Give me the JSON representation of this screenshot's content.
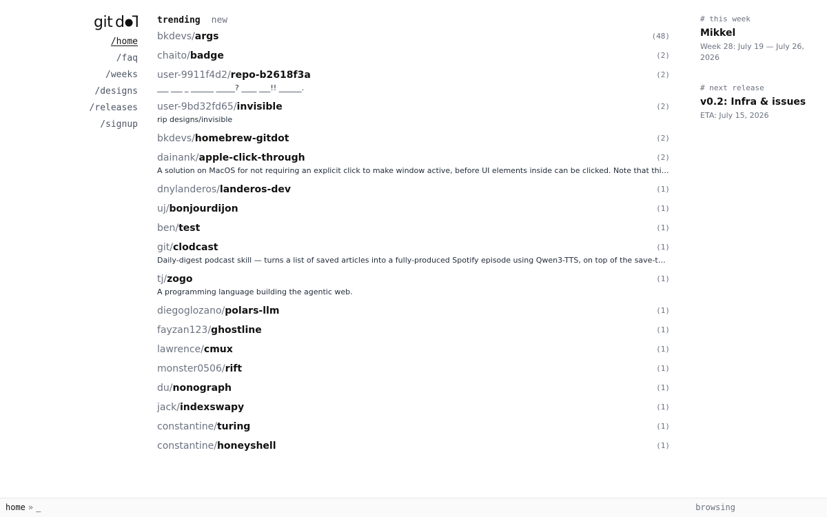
{
  "nav": {
    "logo_text": "gitdot",
    "links": [
      {
        "label": "/home",
        "active": true
      },
      {
        "label": "/faq",
        "active": false
      },
      {
        "label": "/weeks",
        "active": false
      },
      {
        "label": "/designs",
        "active": false
      },
      {
        "label": "/releases",
        "active": false
      },
      {
        "label": "/signup",
        "active": false
      }
    ]
  },
  "tabs": [
    {
      "label": "trending",
      "active": true
    },
    {
      "label": "new",
      "active": false
    }
  ],
  "repos": [
    {
      "owner": "bkdevs/",
      "name": "args",
      "count": "(48)",
      "description": ""
    },
    {
      "owner": "chaito/",
      "name": "badge",
      "count": "(2)",
      "description": ""
    },
    {
      "owner": "user-9911f4d2/",
      "name": "repo-b2618f3a",
      "count": "(2)",
      "description": "___ ___ _ ______ _____? ____ ___!! ______."
    },
    {
      "owner": "user-9bd32fd65/",
      "name": "invisible",
      "count": "(2)",
      "description": "rip designs/invisible"
    },
    {
      "owner": "bkdevs/",
      "name": "homebrew-gitdot",
      "count": "(2)",
      "description": ""
    },
    {
      "owner": "dainank/",
      "name": "apple-click-through",
      "count": "(2)",
      "description": "A solution on MacOS for not requiring an explicit click to make window active, before UI elements inside can be clicked. Note that this requires accessibility permissions."
    },
    {
      "owner": "dnylanderos/",
      "name": "landeros-dev",
      "count": "(1)",
      "description": ""
    },
    {
      "owner": "uj/",
      "name": "bonjourdijon",
      "count": "(1)",
      "description": ""
    },
    {
      "owner": "ben/",
      "name": "test",
      "count": "(1)",
      "description": ""
    },
    {
      "owner": "git/",
      "name": "clodcast",
      "count": "(1)",
      "description": "Daily-digest podcast skill — turns a list of saved articles into a fully-produced Spotify episode using Qwen3-TTS, on top of the save-to-podcast pipeline."
    },
    {
      "owner": "tj/",
      "name": "zogo",
      "count": "(1)",
      "description": "A programming language building the agentic web."
    },
    {
      "owner": "diegoglozano/",
      "name": "polars-llm",
      "count": "(1)",
      "description": ""
    },
    {
      "owner": "fayzan123/",
      "name": "ghostline",
      "count": "(1)",
      "description": ""
    },
    {
      "owner": "lawrence/",
      "name": "cmux",
      "count": "(1)",
      "description": ""
    },
    {
      "owner": "monster0506/",
      "name": "rift",
      "count": "(1)",
      "description": ""
    },
    {
      "owner": "du/",
      "name": "nonograph",
      "count": "(1)",
      "description": ""
    },
    {
      "owner": "jack/",
      "name": "indexswapy",
      "count": "(1)",
      "description": ""
    },
    {
      "owner": "constantine/",
      "name": "turing",
      "count": "(1)",
      "description": ""
    },
    {
      "owner": "constantine/",
      "name": "honeyshell",
      "count": "(1)",
      "description": ""
    }
  ],
  "aside": {
    "this_week": {
      "label": "# this week",
      "title": "Mikkel",
      "subtitle": "Week 28: July 19 — July 26, 2026"
    },
    "next_release": {
      "label": "# next release",
      "title": "v0.2: Infra & issues",
      "subtitle": "ETA: July 15, 2026"
    }
  },
  "statusbar": {
    "path": "home",
    "separator": "»",
    "cursor": "_",
    "mode": "browsing"
  }
}
